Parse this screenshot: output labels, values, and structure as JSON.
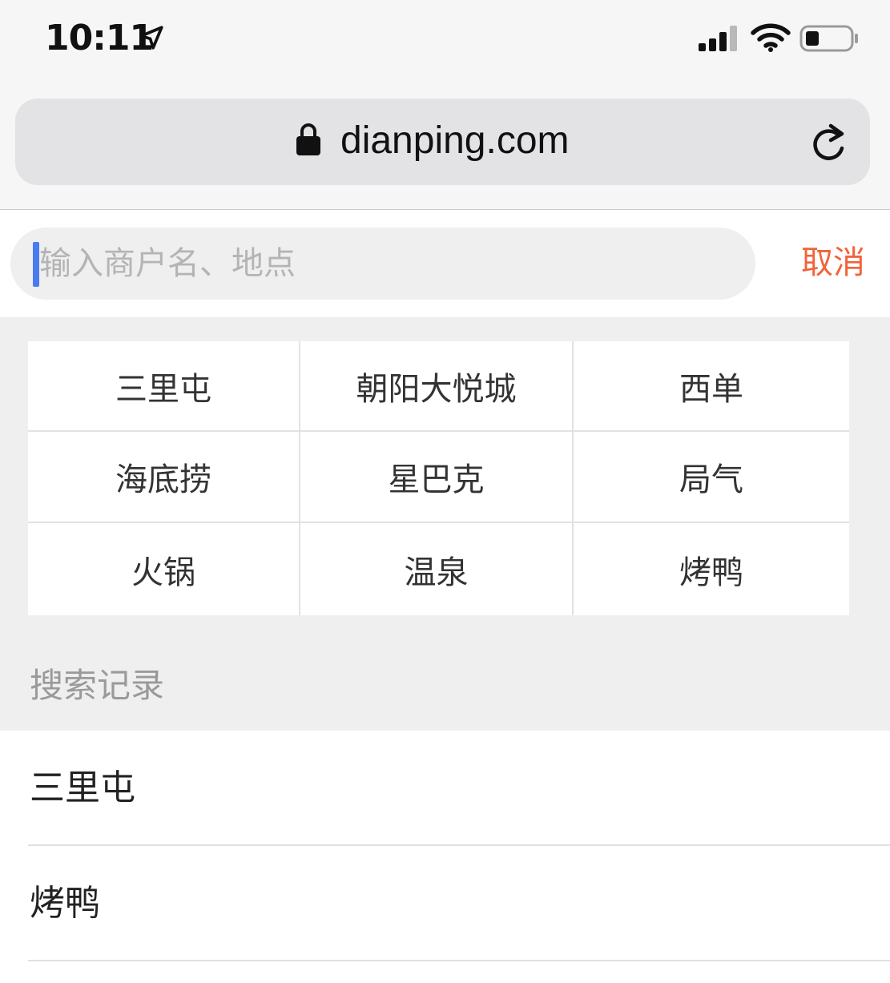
{
  "status_bar": {
    "time": "10:11"
  },
  "browser": {
    "url": "dianping.com"
  },
  "search": {
    "placeholder": "输入商户名、地点",
    "value": "",
    "cancel_label": "取消"
  },
  "hot_searches": [
    {
      "label": "三里屯"
    },
    {
      "label": "朝阳大悦城"
    },
    {
      "label": "西单"
    },
    {
      "label": "海底捞"
    },
    {
      "label": "星巴克"
    },
    {
      "label": "局气"
    },
    {
      "label": "火锅"
    },
    {
      "label": "温泉"
    },
    {
      "label": "烤鸭"
    }
  ],
  "history": {
    "title": "搜索记录",
    "items": [
      {
        "label": "三里屯"
      },
      {
        "label": "烤鸭"
      }
    ]
  },
  "colors": {
    "accent": "#f0643a",
    "caret": "#4a7cf0",
    "page_background": "#efefef"
  }
}
